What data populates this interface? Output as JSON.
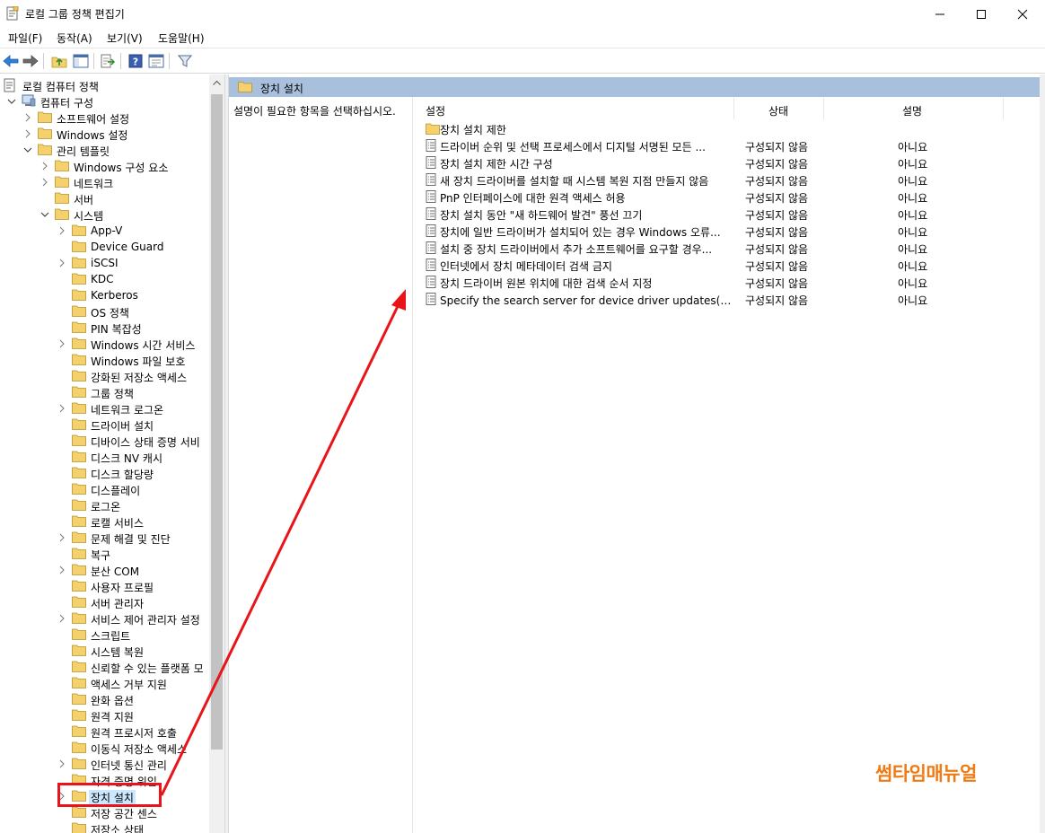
{
  "window": {
    "title": "로컬 그룹 정책 편집기"
  },
  "menu": [
    "파일(F)",
    "동작(A)",
    "보기(V)",
    "도움말(H)"
  ],
  "toolbar": {
    "buttons": [
      "back-icon",
      "forward-icon",
      "up-folder-icon",
      "show-hide-tree-icon",
      "export-list-icon",
      "help-icon",
      "properties-view-icon",
      "filter-icon"
    ]
  },
  "tree": [
    {
      "label": "로컬 컴퓨터 정책",
      "level": 0,
      "expander": "none",
      "icon": "policy"
    },
    {
      "label": "컴퓨터 구성",
      "level": 1,
      "expander": "open",
      "icon": "computer"
    },
    {
      "label": "소프트웨어 설정",
      "level": 2,
      "expander": "closed",
      "icon": "folder"
    },
    {
      "label": "Windows 설정",
      "level": 2,
      "expander": "closed",
      "icon": "folder"
    },
    {
      "label": "관리 템플릿",
      "level": 2,
      "expander": "open",
      "icon": "folder"
    },
    {
      "label": "Windows 구성 요소",
      "level": 3,
      "expander": "closed",
      "icon": "folder"
    },
    {
      "label": "네트워크",
      "level": 3,
      "expander": "closed",
      "icon": "folder"
    },
    {
      "label": "서버",
      "level": 3,
      "expander": "none",
      "icon": "folder"
    },
    {
      "label": "시스템",
      "level": 3,
      "expander": "open",
      "icon": "folder"
    },
    {
      "label": "App-V",
      "level": 4,
      "expander": "closed",
      "icon": "folder"
    },
    {
      "label": "Device Guard",
      "level": 4,
      "expander": "none",
      "icon": "folder"
    },
    {
      "label": "iSCSI",
      "level": 4,
      "expander": "closed",
      "icon": "folder"
    },
    {
      "label": "KDC",
      "level": 4,
      "expander": "none",
      "icon": "folder"
    },
    {
      "label": "Kerberos",
      "level": 4,
      "expander": "none",
      "icon": "folder"
    },
    {
      "label": "OS 정책",
      "level": 4,
      "expander": "none",
      "icon": "folder"
    },
    {
      "label": "PIN 복잡성",
      "level": 4,
      "expander": "none",
      "icon": "folder"
    },
    {
      "label": "Windows 시간 서비스",
      "level": 4,
      "expander": "closed",
      "icon": "folder"
    },
    {
      "label": "Windows 파일 보호",
      "level": 4,
      "expander": "none",
      "icon": "folder"
    },
    {
      "label": "강화된 저장소 액세스",
      "level": 4,
      "expander": "none",
      "icon": "folder"
    },
    {
      "label": "그룹 정책",
      "level": 4,
      "expander": "none",
      "icon": "folder"
    },
    {
      "label": "네트워크 로그온",
      "level": 4,
      "expander": "closed",
      "icon": "folder"
    },
    {
      "label": "드라이버 설치",
      "level": 4,
      "expander": "none",
      "icon": "folder"
    },
    {
      "label": "디바이스 상태 증명 서비",
      "level": 4,
      "expander": "none",
      "icon": "folder"
    },
    {
      "label": "디스크 NV 캐시",
      "level": 4,
      "expander": "none",
      "icon": "folder"
    },
    {
      "label": "디스크 할당량",
      "level": 4,
      "expander": "none",
      "icon": "folder"
    },
    {
      "label": "디스플레이",
      "level": 4,
      "expander": "none",
      "icon": "folder"
    },
    {
      "label": "로그온",
      "level": 4,
      "expander": "none",
      "icon": "folder"
    },
    {
      "label": "로캘 서비스",
      "level": 4,
      "expander": "none",
      "icon": "folder"
    },
    {
      "label": "문제 해결 및 진단",
      "level": 4,
      "expander": "closed",
      "icon": "folder"
    },
    {
      "label": "복구",
      "level": 4,
      "expander": "none",
      "icon": "folder"
    },
    {
      "label": "분산 COM",
      "level": 4,
      "expander": "closed",
      "icon": "folder"
    },
    {
      "label": "사용자 프로필",
      "level": 4,
      "expander": "none",
      "icon": "folder"
    },
    {
      "label": "서버 관리자",
      "level": 4,
      "expander": "none",
      "icon": "folder"
    },
    {
      "label": "서비스 제어 관리자 설정",
      "level": 4,
      "expander": "closed",
      "icon": "folder"
    },
    {
      "label": "스크립트",
      "level": 4,
      "expander": "none",
      "icon": "folder"
    },
    {
      "label": "시스템 복원",
      "level": 4,
      "expander": "none",
      "icon": "folder"
    },
    {
      "label": "신뢰할 수 있는 플랫폼 모",
      "level": 4,
      "expander": "none",
      "icon": "folder"
    },
    {
      "label": "액세스 거부 지원",
      "level": 4,
      "expander": "none",
      "icon": "folder"
    },
    {
      "label": "완화 옵션",
      "level": 4,
      "expander": "none",
      "icon": "folder"
    },
    {
      "label": "원격 지원",
      "level": 4,
      "expander": "none",
      "icon": "folder"
    },
    {
      "label": "원격 프로시저 호출",
      "level": 4,
      "expander": "none",
      "icon": "folder"
    },
    {
      "label": "이동식 저장소 액세스",
      "level": 4,
      "expander": "none",
      "icon": "folder"
    },
    {
      "label": "인터넷 통신 관리",
      "level": 4,
      "expander": "closed",
      "icon": "folder"
    },
    {
      "label": "자격 증명 위임",
      "level": 4,
      "expander": "none",
      "icon": "folder"
    },
    {
      "label": "장치 설치",
      "level": 4,
      "expander": "closed",
      "icon": "folder",
      "selected": true
    },
    {
      "label": "저장 공간 센스",
      "level": 4,
      "expander": "none",
      "icon": "folder"
    },
    {
      "label": "저장소 상태",
      "level": 4,
      "expander": "none",
      "icon": "folder"
    }
  ],
  "right": {
    "folder_title": "장치 설치",
    "description_hint": "설명이 필요한 항목을 선택하십시오.",
    "columns": {
      "setting": "설정",
      "state": "상태",
      "comment": "설명"
    },
    "subfolder": "장치 설치 제한",
    "items": [
      {
        "name": "드라이버 순위 및 선택 프로세스에서 디지털 서명된 모든 ...",
        "state": "구성되지 않음",
        "comment": "아니요"
      },
      {
        "name": "장치 설치 제한 시간 구성",
        "state": "구성되지 않음",
        "comment": "아니요"
      },
      {
        "name": "새 장치 드라이버를 설치할 때 시스템 복원 지점 만들지 않음",
        "state": "구성되지 않음",
        "comment": "아니요"
      },
      {
        "name": "PnP 인터페이스에 대한 원격 액세스 허용",
        "state": "구성되지 않음",
        "comment": "아니요"
      },
      {
        "name": "장치 설치 동안 \"새 하드웨어 발견\" 풍선 끄기",
        "state": "구성되지 않음",
        "comment": "아니요"
      },
      {
        "name": "장치에 일반 드라이버가 설치되어 있는 경우 Windows 오류...",
        "state": "구성되지 않음",
        "comment": "아니요"
      },
      {
        "name": "설치 중 장치 드라이버에서 추가 소프트웨어를 요구할 경우...",
        "state": "구성되지 않음",
        "comment": "아니요"
      },
      {
        "name": "인터넷에서 장치 메타데이터 검색 금지",
        "state": "구성되지 않음",
        "comment": "아니요"
      },
      {
        "name": "장치 드라이버 원본 위치에 대한 검색 순서 지정",
        "state": "구성되지 않음",
        "comment": "아니요"
      },
      {
        "name": "Specify the search server for device driver updates(장치 드...",
        "state": "구성되지 않음",
        "comment": "아니요"
      }
    ]
  },
  "watermark": "썸타임매뉴얼",
  "colors": {
    "header_band": "#a9c0dc",
    "selection": "#cce8ff",
    "annotation_red": "#e8141a",
    "watermark_orange": "#f07a14",
    "folder_yellow": "#f5d16e"
  }
}
